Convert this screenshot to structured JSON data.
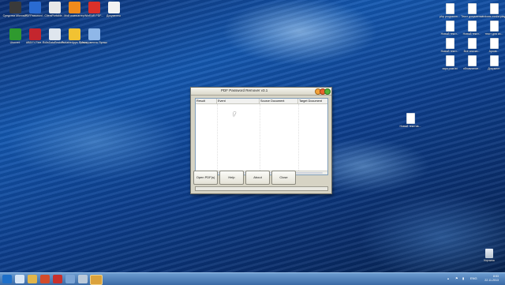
{
  "desktop_left_row1": [
    {
      "label": "Средства Microsoft",
      "color": "#3a3a3a"
    },
    {
      "label": "PDFPassword...",
      "color": "#2a6bd1"
    },
    {
      "label": "ClientPortable...",
      "color": "#e8e8e8"
    },
    {
      "label": "Мой компьютер",
      "color": "#f08a1c"
    },
    {
      "label": "WinRAR PDF...",
      "color": "#d9302a"
    },
    {
      "label": "Документы",
      "color": "#f2f2f2"
    }
  ],
  "desktop_left_row2": [
    {
      "label": "Utorrent",
      "color": "#2f9a2f"
    },
    {
      "label": "ABBYY Fine...",
      "color": "#c4262e"
    },
    {
      "label": "RollsDataRestore...",
      "color": "#dfe6ee"
    },
    {
      "label": "PortableApps Ярлык",
      "color": "#f1c232"
    },
    {
      "label": "Инструменты Ярлык",
      "color": "#8fb7e8"
    }
  ],
  "desktop_right": [
    {
      "label": "php programm...",
      "col": 0,
      "row": 0
    },
    {
      "label": "Текст документ...",
      "col": 1,
      "row": 0
    },
    {
      "label": "windows media player",
      "col": 2,
      "row": 0
    },
    {
      "label": "Новый текст...",
      "col": 0,
      "row": 1
    },
    {
      "label": "Новый текст...",
      "col": 1,
      "row": 1
    },
    {
      "label": "текст для ис...",
      "col": 2,
      "row": 1
    },
    {
      "label": "Новый текст...",
      "col": 0,
      "row": 2
    },
    {
      "label": "Все списки...",
      "col": 1,
      "row": 2
    },
    {
      "label": "Архив...",
      "col": 2,
      "row": 2
    },
    {
      "label": "заря ром.txt",
      "col": 0,
      "row": 3
    },
    {
      "label": "обновление...",
      "col": 1,
      "row": 3
    },
    {
      "label": "Документ",
      "col": 2,
      "row": 3
    }
  ],
  "desktop_mid_file": "Новый текстов...",
  "recycle_bin": "Корзина",
  "window": {
    "title": "PDF Password Remover v3.1",
    "columns": [
      "Result",
      "Event",
      "Source Document",
      "Target Document"
    ],
    "buttons": {
      "open": "Open PDF(s)",
      "help": "Help",
      "about": "About",
      "close": "Close"
    },
    "progress": 0.0
  },
  "taskbar": {
    "lang": "ENG",
    "time": "8:53",
    "date": "22.11.2013"
  }
}
